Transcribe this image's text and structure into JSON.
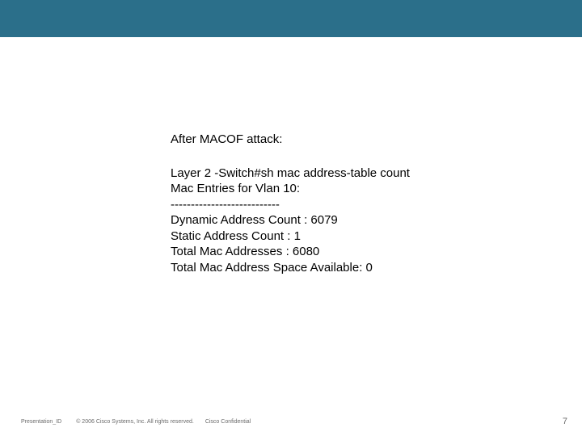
{
  "topBand": {
    "color": "#2b6f8a"
  },
  "body": {
    "intro": "After MACOF attack:",
    "cmd": "Layer 2 -Switch#sh mac address-table count",
    "vlanHeader": "Mac Entries for Vlan 10:",
    "divider": "---------------------------",
    "dynCount": "Dynamic Address Count  : 6079",
    "staticCount": "Static  Address Count   : 1",
    "totalMac": "Total Mac Addresses    : 6080",
    "spaceAvail": "Total Mac Address Space Available: 0"
  },
  "footer": {
    "presentationId": "Presentation_ID",
    "copyright": "© 2006 Cisco Systems, Inc. All rights reserved.",
    "confidential": "Cisco Confidential",
    "pageNumber": "7"
  }
}
